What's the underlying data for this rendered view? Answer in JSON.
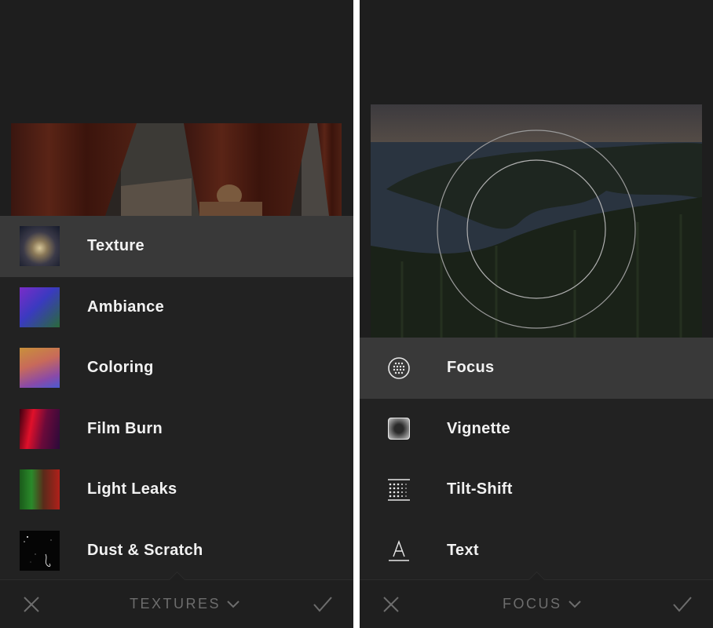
{
  "left_panel": {
    "items": [
      {
        "label": "Texture"
      },
      {
        "label": "Ambiance"
      },
      {
        "label": "Coloring"
      },
      {
        "label": "Film Burn"
      },
      {
        "label": "Light Leaks"
      },
      {
        "label": "Dust & Scratch"
      }
    ],
    "selected_index": 0,
    "toolbar": {
      "title": "TEXTURES",
      "cancel_icon": "close-icon",
      "confirm_icon": "checkmark-icon",
      "dropdown_icon": "chevron-down-icon"
    }
  },
  "right_panel": {
    "items": [
      {
        "label": "Focus",
        "icon": "focus-dots-icon"
      },
      {
        "label": "Vignette",
        "icon": "vignette-icon"
      },
      {
        "label": "Tilt-Shift",
        "icon": "tilt-shift-icon"
      },
      {
        "label": "Text",
        "icon": "text-a-icon"
      }
    ],
    "selected_index": 0,
    "toolbar": {
      "title": "FOCUS",
      "cancel_icon": "close-icon",
      "confirm_icon": "checkmark-icon",
      "dropdown_icon": "chevron-down-icon"
    }
  },
  "colors": {
    "background": "#1e1e1e",
    "selected_row": "#393939",
    "label": "#f2f2f2",
    "toolbar_text": "#6d6d6d"
  }
}
